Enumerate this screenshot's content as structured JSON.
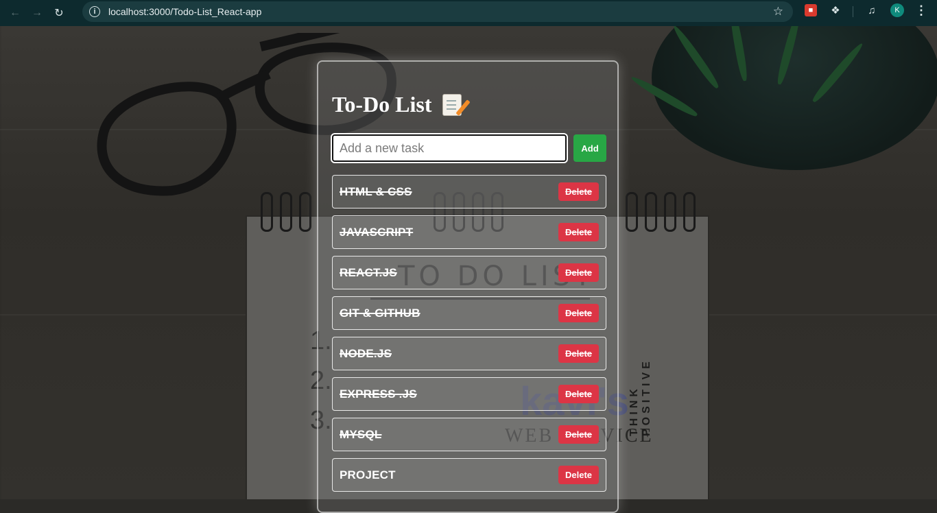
{
  "browser": {
    "url": "localhost:3000/Todo-List_React-app",
    "profile_initial": "K",
    "icons": [
      "back-arrow-icon",
      "forward-arrow-icon",
      "reload-icon",
      "site-info-icon",
      "bookmark-star-icon",
      "extension-icon",
      "puzzle-icon",
      "media-control-icon",
      "profile-avatar",
      "more-menu-icon"
    ]
  },
  "background": {
    "notebook_heading": "TO DO LIST",
    "notebook_numbers": [
      "1.",
      "2.",
      "3."
    ],
    "side_text": "THINK POSITIVE",
    "watermark_brand": "kavi's",
    "watermark_sub": "WEB SERVICE"
  },
  "todo": {
    "title": "To-Do List",
    "title_icon": "memo-icon",
    "input_placeholder": "Add a new task",
    "add_label": "Add",
    "delete_label": "Delete",
    "tasks": [
      {
        "label": "HTML & CSS",
        "completed": true
      },
      {
        "label": "JAVASCRIPT",
        "completed": true
      },
      {
        "label": "REACT.JS",
        "completed": true
      },
      {
        "label": "GIT & GITHUB",
        "completed": true
      },
      {
        "label": "NODE.JS",
        "completed": true
      },
      {
        "label": "EXPRESS .JS",
        "completed": true
      },
      {
        "label": "MYSQL",
        "completed": true
      },
      {
        "label": "PROJECT",
        "completed": false
      }
    ]
  },
  "colors": {
    "add_button": "#28a745",
    "delete_button": "#dc3545",
    "chrome_bg": "#0d2a2e"
  }
}
